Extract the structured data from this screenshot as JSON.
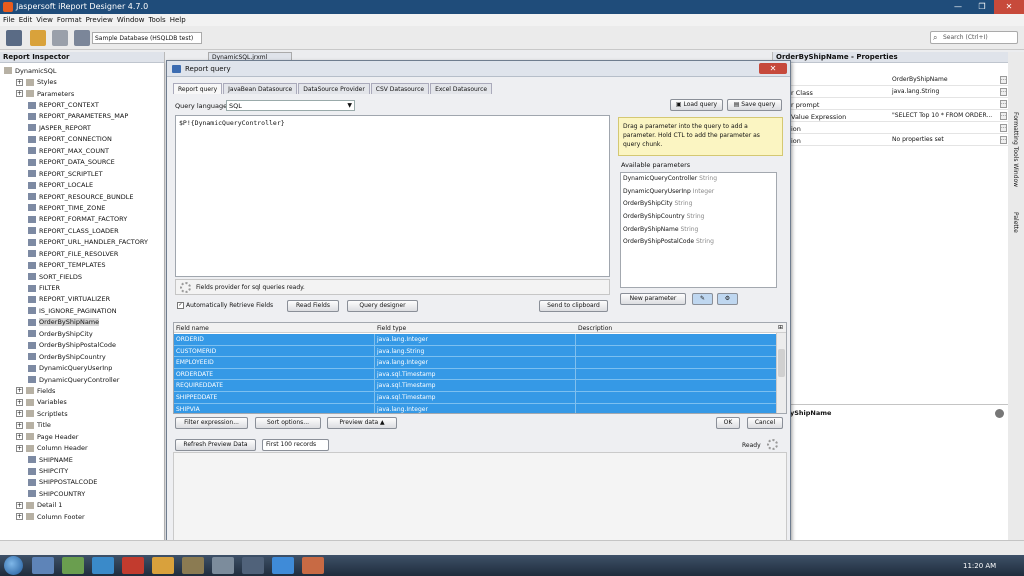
{
  "window": {
    "title": "Jaspersoft iReport Designer 4.7.0",
    "min": "—",
    "max": "❐",
    "close": "✕"
  },
  "menu": [
    "File",
    "Edit",
    "View",
    "Format",
    "Preview",
    "Window",
    "Tools",
    "Help"
  ],
  "toolbar": {
    "datasource": "Sample Database (HSQLDB test)",
    "search_placeholder": "Search (Ctrl+I)"
  },
  "inspector": {
    "title": "Report Inspector",
    "tree": [
      {
        "label": "DynamicSQL",
        "indent": 0
      },
      {
        "label": "Styles",
        "indent": 1
      },
      {
        "label": "Parameters",
        "indent": 1
      },
      {
        "label": "REPORT_CONTEXT",
        "indent": 2
      },
      {
        "label": "REPORT_PARAMETERS_MAP",
        "indent": 2
      },
      {
        "label": "JASPER_REPORT",
        "indent": 2
      },
      {
        "label": "REPORT_CONNECTION",
        "indent": 2
      },
      {
        "label": "REPORT_MAX_COUNT",
        "indent": 2
      },
      {
        "label": "REPORT_DATA_SOURCE",
        "indent": 2
      },
      {
        "label": "REPORT_SCRIPTLET",
        "indent": 2
      },
      {
        "label": "REPORT_LOCALE",
        "indent": 2
      },
      {
        "label": "REPORT_RESOURCE_BUNDLE",
        "indent": 2
      },
      {
        "label": "REPORT_TIME_ZONE",
        "indent": 2
      },
      {
        "label": "REPORT_FORMAT_FACTORY",
        "indent": 2
      },
      {
        "label": "REPORT_CLASS_LOADER",
        "indent": 2
      },
      {
        "label": "REPORT_URL_HANDLER_FACTORY",
        "indent": 2
      },
      {
        "label": "REPORT_FILE_RESOLVER",
        "indent": 2
      },
      {
        "label": "REPORT_TEMPLATES",
        "indent": 2
      },
      {
        "label": "SORT_FIELDS",
        "indent": 2
      },
      {
        "label": "FILTER",
        "indent": 2
      },
      {
        "label": "REPORT_VIRTUALIZER",
        "indent": 2
      },
      {
        "label": "IS_IGNORE_PAGINATION",
        "indent": 2
      },
      {
        "label": "OrderByShipName",
        "indent": 2,
        "selected": true
      },
      {
        "label": "OrderByShipCity",
        "indent": 2
      },
      {
        "label": "OrderByShipPostalCode",
        "indent": 2
      },
      {
        "label": "OrderByShipCountry",
        "indent": 2
      },
      {
        "label": "DynamicQueryUserInp",
        "indent": 2
      },
      {
        "label": "DynamicQueryController",
        "indent": 2
      },
      {
        "label": "Fields",
        "indent": 1
      },
      {
        "label": "Variables",
        "indent": 1
      },
      {
        "label": "Scriptlets",
        "indent": 1
      },
      {
        "label": "Title",
        "indent": 1
      },
      {
        "label": "Page Header",
        "indent": 1
      },
      {
        "label": "Column Header",
        "indent": 1
      },
      {
        "label": "SHIPNAME",
        "indent": 2
      },
      {
        "label": "SHIPCITY",
        "indent": 2
      },
      {
        "label": "SHIPPOSTALCODE",
        "indent": 2
      },
      {
        "label": "SHIPCOUNTRY",
        "indent": 2
      },
      {
        "label": "Detail 1",
        "indent": 1
      },
      {
        "label": "Column Footer",
        "indent": 1
      }
    ]
  },
  "doc_tab": "DynamicSQL.jrxml",
  "properties": {
    "title": "OrderByShipName - Properties",
    "rows": [
      {
        "key": "",
        "value": "OrderByShipName"
      },
      {
        "key": "r Class",
        "value": "java.lang.String"
      },
      {
        "key": "r prompt",
        "value": ""
      },
      {
        "key": "Value Expression",
        "value": "\"SELECT Top 10 * FROM ORDER..."
      },
      {
        "key": "ion",
        "value": ""
      },
      {
        "key": "ion",
        "value": "No properties set"
      }
    ],
    "bottom_title": "yShipName"
  },
  "side_tabs": [
    "Formatting Tools Window",
    "Palette"
  ],
  "dialog": {
    "title": "Report query",
    "tabs": [
      "Report query",
      "JavaBean Datasource",
      "DataSource Provider",
      "CSV Datasource",
      "Excel Datasource"
    ],
    "query_language_label": "Query language",
    "query_language": "SQL",
    "load_query": "Load query",
    "save_query": "Save query",
    "query_text": "$P!{DynamicQueryController}",
    "status": "Fields provider for sql queries ready.",
    "auto_retrieve": "Automatically Retrieve Fields",
    "read_fields": "Read Fields",
    "query_designer": "Query designer",
    "send_clipboard": "Send to clipboard",
    "tip": "Drag a parameter into the query to add a parameter. Hold CTL to add the parameter as query chunk.",
    "available_label": "Available parameters",
    "parameters": [
      {
        "name": "DynamicQueryController",
        "type": "String"
      },
      {
        "name": "DynamicQueryUserInp",
        "type": "Integer"
      },
      {
        "name": "OrderByShipCity",
        "type": "String"
      },
      {
        "name": "OrderByShipCountry",
        "type": "String"
      },
      {
        "name": "OrderByShipName",
        "type": "String"
      },
      {
        "name": "OrderByShipPostalCode",
        "type": "String"
      }
    ],
    "new_parameter": "New parameter",
    "columns": [
      "Field name",
      "Field type",
      "Description"
    ],
    "fields": [
      {
        "name": "ORDERID",
        "type": "java.lang.Integer"
      },
      {
        "name": "CUSTOMERID",
        "type": "java.lang.String"
      },
      {
        "name": "EMPLOYEEID",
        "type": "java.lang.Integer"
      },
      {
        "name": "ORDERDATE",
        "type": "java.sql.Timestamp"
      },
      {
        "name": "REQUIREDDATE",
        "type": "java.sql.Timestamp"
      },
      {
        "name": "SHIPPEDDATE",
        "type": "java.sql.Timestamp"
      },
      {
        "name": "SHIPVIA",
        "type": "java.lang.Integer"
      }
    ],
    "filter_expression": "Filter expression...",
    "sort_options": "Sort options...",
    "preview_data": "Preview data ▲",
    "ok": "OK",
    "cancel": "Cancel",
    "refresh_preview": "Refresh Preview Data",
    "rows_select": "First 100 records",
    "ready": "Ready"
  },
  "taskbar": {
    "time": "11:20 AM"
  }
}
